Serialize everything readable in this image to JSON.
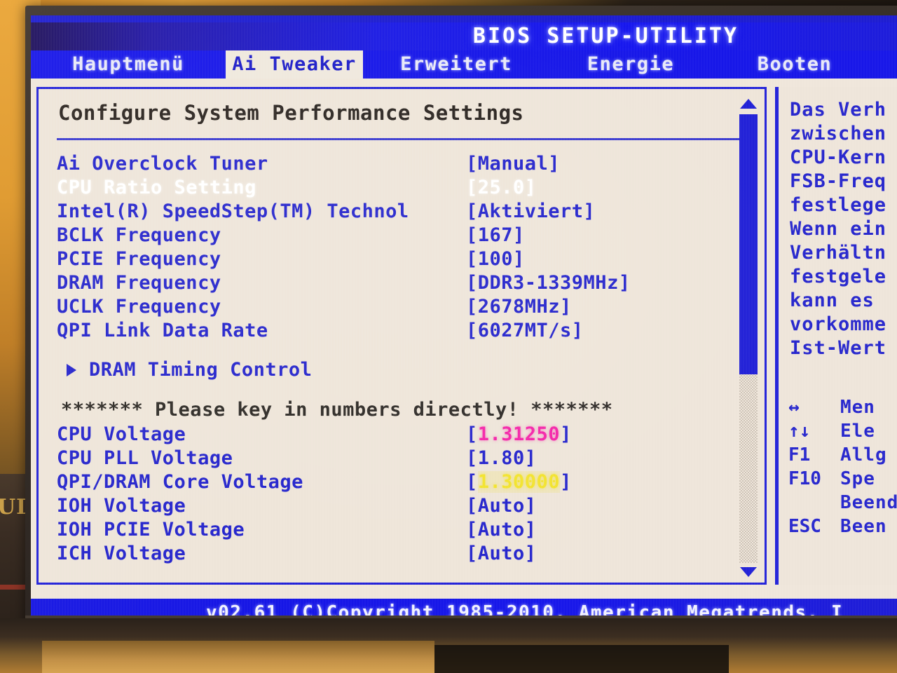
{
  "window": {
    "title": "BIOS SETUP-UTILITY"
  },
  "menubar": {
    "tabs": [
      {
        "label": "Hauptmenü",
        "active": false
      },
      {
        "label": "Ai Tweaker",
        "active": true
      },
      {
        "label": "Erweitert",
        "active": false
      },
      {
        "label": "Energie",
        "active": false
      },
      {
        "label": "Booten",
        "active": false
      }
    ]
  },
  "main": {
    "section_title": "Configure System Performance Settings",
    "rows": [
      {
        "label": "Ai Overclock Tuner",
        "value": "[Manual]",
        "selected": false
      },
      {
        "label": "CPU Ratio Setting",
        "value": "[25.0]",
        "selected": true
      },
      {
        "label": "Intel(R) SpeedStep(TM) Technol",
        "value": "[Aktiviert]",
        "selected": false
      },
      {
        "label": "BCLK Frequency",
        "value": "[167]",
        "selected": false
      },
      {
        "label": "PCIE Frequency",
        "value": "[100]",
        "selected": false
      },
      {
        "label": "DRAM Frequency",
        "value": "[DDR3-1339MHz]",
        "selected": false
      },
      {
        "label": "UCLK Frequency",
        "value": "[2678MHz]",
        "selected": false
      },
      {
        "label": "QPI Link Data Rate",
        "value": "[6027MT/s]",
        "selected": false
      }
    ],
    "submenu": {
      "label": "DRAM Timing Control"
    },
    "note": "******* Please key in numbers directly! *******",
    "voltage_rows": [
      {
        "label": "CPU Voltage",
        "bracket_open": "[",
        "number": "1.31250",
        "bracket_close": "]",
        "color": "pink"
      },
      {
        "label": "CPU PLL Voltage",
        "bracket_open": "[",
        "number": "1.80",
        "bracket_close": "]",
        "color": "blue"
      },
      {
        "label": "QPI/DRAM Core Voltage",
        "bracket_open": "[",
        "number": "1.30000",
        "bracket_close": "]",
        "color": "yellow"
      },
      {
        "label": "IOH Voltage",
        "bracket_open": "[",
        "number": "Auto",
        "bracket_close": "]",
        "color": "blue"
      },
      {
        "label": "IOH PCIE Voltage",
        "bracket_open": "[",
        "number": "Auto",
        "bracket_close": "]",
        "color": "blue"
      },
      {
        "label": "ICH Voltage",
        "bracket_open": "[",
        "number": "Auto",
        "bracket_close": "]",
        "color": "blue"
      }
    ]
  },
  "help": {
    "lines": [
      "Das Verh",
      "zwischen",
      "CPU-Kern",
      "FSB-Freq",
      "festlege",
      "Wenn ein",
      "Verhältn",
      "festgele",
      "kann es",
      "vorkomme",
      "Ist-Wert"
    ]
  },
  "legend": {
    "rows": [
      {
        "key": "↔",
        "desc": "Men"
      },
      {
        "key": "↑↓",
        "desc": "Ele"
      },
      {
        "key": "F1",
        "desc": "Allg"
      },
      {
        "key": "F10",
        "desc": "Spe"
      },
      {
        "key": "",
        "desc": "Beend"
      },
      {
        "key": "ESC",
        "desc": "Been"
      }
    ]
  },
  "footer": {
    "text": "v02.61 (C)Copyright 1985-2010, American Megatrends, I"
  },
  "scrollbar": {
    "thumb_percent": 58,
    "up_arrow": "scroll-up-arrow",
    "down_arrow": "scroll-down-arrow"
  },
  "environment": {
    "book_text": "UD"
  },
  "colors": {
    "screen_blue": "#1515e8",
    "text_blue": "#2424cc",
    "selected_white": "#ffffff",
    "value_pink": "#f425a8",
    "value_yellow": "#f2e32c",
    "panel_bg": "#efe6da",
    "wall": "#e09c33"
  }
}
